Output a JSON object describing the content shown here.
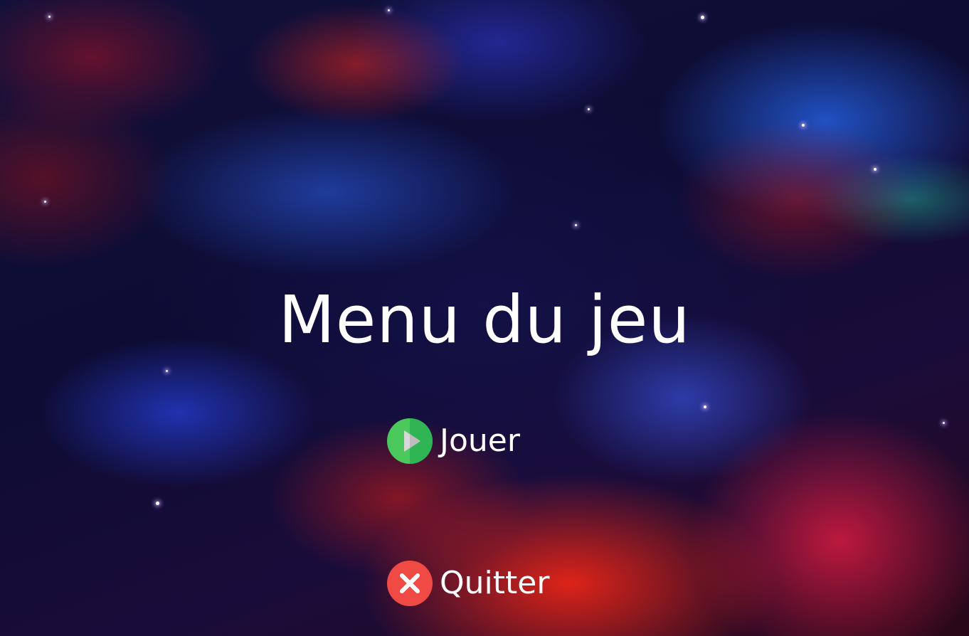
{
  "menu": {
    "title": "Menu du jeu",
    "buttons": [
      {
        "label": "Jouer",
        "icon": "play-icon",
        "color": "#4cc95c"
      },
      {
        "label": "Quitter",
        "icon": "close-icon",
        "color": "#ef4a43"
      }
    ]
  }
}
